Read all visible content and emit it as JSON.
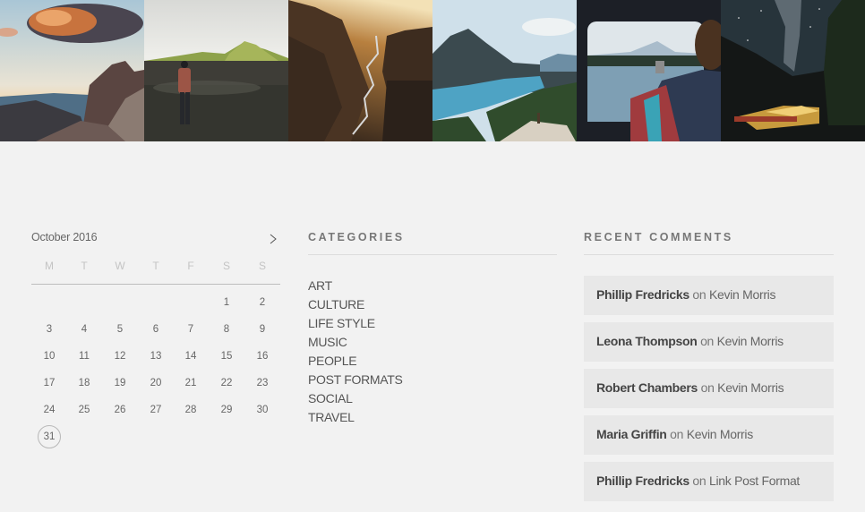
{
  "photo_strip": {
    "photos": [
      {
        "subject": "sunset-cloud-over-mountain-peaks"
      },
      {
        "subject": "man-walking-toward-green-hills"
      },
      {
        "subject": "sunlit-canyon-with-river"
      },
      {
        "subject": "turquoise-mountain-lake"
      },
      {
        "subject": "woman-in-van-by-lake"
      },
      {
        "subject": "milky-way-over-campsite"
      }
    ]
  },
  "calendar": {
    "month_label": "October 2016",
    "next_icon": "chevron-right-icon",
    "weekdays": [
      "M",
      "T",
      "W",
      "T",
      "F",
      "S",
      "S"
    ],
    "weeks": [
      [
        "",
        "",
        "",
        "",
        "",
        "1",
        "2"
      ],
      [
        "3",
        "4",
        "5",
        "6",
        "7",
        "8",
        "9"
      ],
      [
        "10",
        "11",
        "12",
        "13",
        "14",
        "15",
        "16"
      ],
      [
        "17",
        "18",
        "19",
        "20",
        "21",
        "22",
        "23"
      ],
      [
        "24",
        "25",
        "26",
        "27",
        "28",
        "29",
        "30"
      ],
      [
        "31",
        "",
        "",
        "",
        "",
        "",
        ""
      ]
    ],
    "today": "31"
  },
  "categories": {
    "title": "CATEGORIES",
    "items": [
      "ART",
      "CULTURE",
      "LIFE STYLE",
      "MUSIC",
      "PEOPLE",
      "POST FORMATS",
      "SOCIAL",
      "TRAVEL"
    ]
  },
  "recent_comments": {
    "title": "RECENT COMMENTS",
    "connector": "on",
    "items": [
      {
        "author": "Phillip Fredricks",
        "post": "Kevin Morris"
      },
      {
        "author": "Leona Thompson",
        "post": "Kevin Morris"
      },
      {
        "author": "Robert Chambers",
        "post": "Kevin Morris"
      },
      {
        "author": "Maria Griffin",
        "post": "Kevin Morris"
      },
      {
        "author": "Phillip Fredricks",
        "post": "Link Post Format"
      }
    ]
  }
}
